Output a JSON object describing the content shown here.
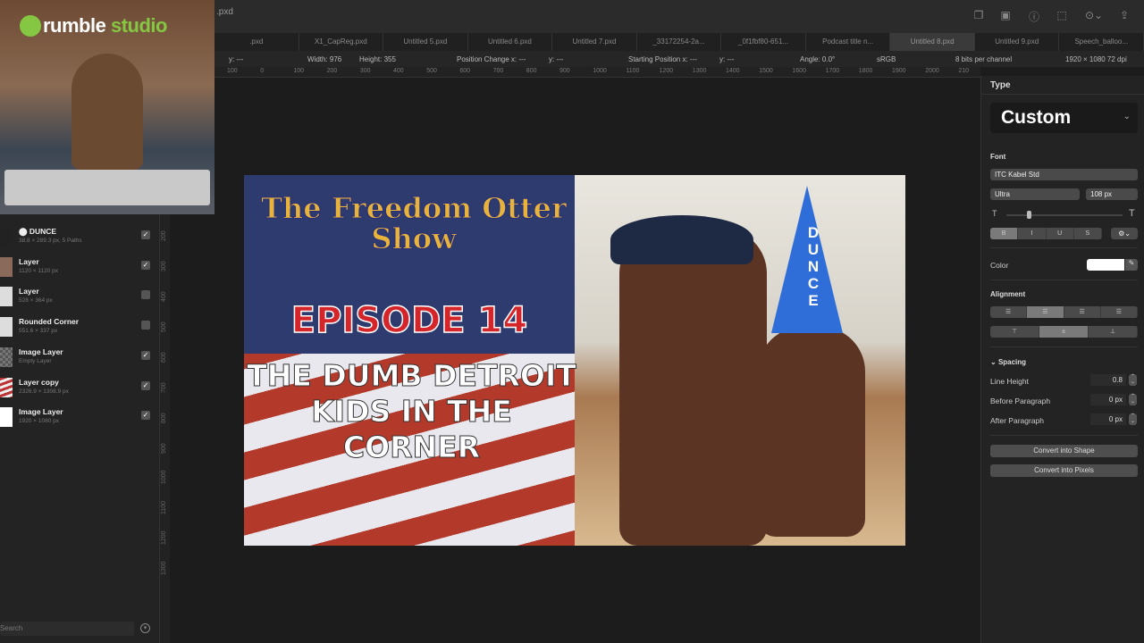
{
  "window": {
    "doc_title": ".pxd",
    "toolbar_icons": [
      "duplicate-icon",
      "export-icon",
      "info-icon",
      "rotate-icon",
      "more-icon",
      "share-icon"
    ]
  },
  "tabs": [
    ".pxd",
    "X1_CapReg.pxd",
    "Untitled 5.pxd",
    "Untitled 6.pxd",
    "Untitled 7.pxd",
    "_33172254-2a...",
    "_0f1fbf80-651...",
    "Podcast title n...",
    "Untitled 8.pxd",
    "Untitled 9.pxd",
    "Speech_balloo..."
  ],
  "active_tab": 8,
  "infobar": {
    "y": "y: ---",
    "width": "Width: 976",
    "height": "Height: 355",
    "pos_change_x": "Position Change x: ---",
    "pos_change_y": "y: ---",
    "start_x": "Starting Position x: ---",
    "start_y": "y: ---",
    "angle": "Angle: 0.0°",
    "colorspace": "sRGB",
    "depth": "8 bits per channel",
    "doc_size": "1920 × 1080 72 dpi"
  },
  "hruler": [
    "100",
    "0",
    "100",
    "200",
    "300",
    "400",
    "500",
    "600",
    "700",
    "800",
    "900",
    "1000",
    "1100",
    "1200",
    "1300",
    "1400",
    "1500",
    "1600",
    "1700",
    "1800",
    "1900",
    "2000",
    "210"
  ],
  "vruler": [
    "200",
    "300",
    "400",
    "500",
    "600",
    "700",
    "800",
    "900",
    "1000",
    "1100",
    "1200",
    "1300"
  ],
  "webcam": {
    "logo_a": "rumble",
    "logo_b": " studio"
  },
  "layers": [
    {
      "name": "DUNCE",
      "dims": "38.8 × 289.3 px, 5 Paths",
      "checked": true
    },
    {
      "name": "Layer",
      "dims": "1120 × 1120 px",
      "checked": true
    },
    {
      "name": "Layer",
      "dims": "528 × 364 px",
      "checked": false
    },
    {
      "name": "Rounded Corner",
      "dims": "551.6 × 337 px",
      "checked": false
    },
    {
      "name": "Image Layer",
      "dims": "Empty Layer",
      "checked": true
    },
    {
      "name": "Layer copy",
      "dims": "2326.9 × 1308.9 px",
      "checked": true
    },
    {
      "name": "Image Layer",
      "dims": "1920 × 1080 px",
      "checked": true
    }
  ],
  "search": {
    "placeholder": "Search"
  },
  "canvas": {
    "show_title": "The Freedom Otter Show",
    "episode": "EPISODE 14",
    "headline": "THE DUMB DETROIT KIDS IN THE CORNER",
    "hat_text": "DUNCE"
  },
  "right_panel": {
    "type_heading": "Type",
    "style": "Custom",
    "font_heading": "Font",
    "font_family": "ITC Kabel Std",
    "font_weight": "Ultra",
    "font_size": "108 px",
    "styles": [
      "B",
      "I",
      "U",
      "S"
    ],
    "color_label": "Color",
    "color_value": "#ffffff",
    "alignment_heading": "Alignment",
    "spacing_heading": "Spacing",
    "line_height_label": "Line Height",
    "line_height": "0.8",
    "before_label": "Before Paragraph",
    "before": "0 px",
    "after_label": "After Paragraph",
    "after": "0 px",
    "convert_shape": "Convert into Shape",
    "convert_pixels": "Convert into Pixels"
  }
}
